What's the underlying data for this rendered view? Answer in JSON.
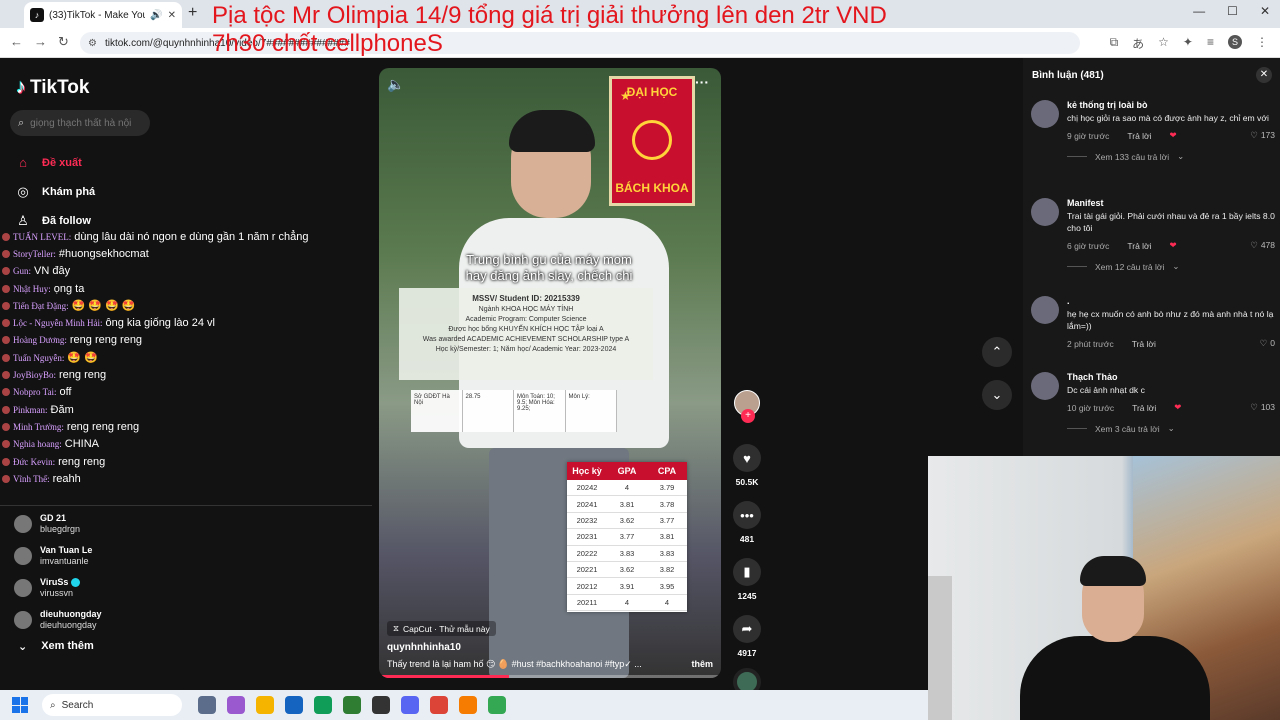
{
  "browser": {
    "tab_title": "(33)TikTok - Make Your Day",
    "tab_audio_icon": "🔊",
    "url": "tiktok.com/@quynhnhinha10/video/7###############",
    "new_tab": "+"
  },
  "headline": {
    "line1": "Pịa tộc Mr Olimpia  14/9 tổng giá trị giải thưởng lên den 2tr VND",
    "line2": "7h30 chốt cellphoneS"
  },
  "tiktok": {
    "logo": "TikTok",
    "search_placeholder": "giọng thạch thất hà nội",
    "nav": [
      {
        "label": "Đề xuất",
        "icon": "home-icon",
        "glyph": "⌂",
        "active": true
      },
      {
        "label": "Khám phá",
        "icon": "compass-icon",
        "glyph": "◎",
        "active": false
      },
      {
        "label": "Đã follow",
        "icon": "user-icon",
        "glyph": "♙",
        "active": false
      }
    ],
    "following": [
      {
        "name": "GD 21",
        "handle": "bluegdrgn",
        "verified": false
      },
      {
        "name": "Van Tuan Le",
        "handle": "imvantuanle",
        "verified": false
      },
      {
        "name": "ViruSs",
        "handle": "virussvn",
        "verified": true
      },
      {
        "name": "dieuhuongday",
        "handle": "dieuhuongday",
        "verified": false
      }
    ],
    "see_more": "Xem thêm"
  },
  "chat": [
    {
      "user": "TUẤN LEVEL:",
      "msg": "dùng lâu dài nó ngon e dùng gần 1 năm r chẳng"
    },
    {
      "user": "StoryTeller:",
      "msg": "#huongsekhocmat"
    },
    {
      "user": "Gun:",
      "msg": "VN đây"
    },
    {
      "user": "Nhật Huy:",
      "msg": "ọng ta"
    },
    {
      "user": "Tiến Đạt Đặng:",
      "msg": "🤩 🤩 🤩 🤩"
    },
    {
      "user": "Lộc - Nguyễn Minh Hải:",
      "msg": "ông kia giống lào 24 vl"
    },
    {
      "user": "Hoàng Dương:",
      "msg": "reng reng reng"
    },
    {
      "user": "Tuấn Nguyễn:",
      "msg": "🤩 🤩"
    },
    {
      "user": "JoyBioyBo:",
      "msg": "reng reng"
    },
    {
      "user": "Nobpro Tai:",
      "msg": "off"
    },
    {
      "user": "Pinkman:",
      "msg": "Đăm"
    },
    {
      "user": "Minh Trường:",
      "msg": "reng reng reng"
    },
    {
      "user": "Nghia hoang:",
      "msg": "CHINA"
    },
    {
      "user": "Đức Kevin:",
      "msg": "reng reng"
    },
    {
      "user": "Vĩnh Thế:",
      "msg": "reahh"
    }
  ],
  "video": {
    "caption_line1": "Trung bình gu của máy mom",
    "caption_line2": "hay đăng ảnh slay, chếch chi",
    "banner_top": "ĐẠI HỌC",
    "banner_bottom": "BÁCH KHOA",
    "cert_student_id": "MSSV/ Student ID: 20215339",
    "cert_major": "Ngành KHOA HỌC MÁY TÍNH",
    "cert_major_en": "Academic Program: Computer Science",
    "cert_award": "Được học bổng KHUYẾN KHÍCH HỌC TẬP loại A",
    "cert_award_en": "Was awarded ACADEMIC ACHIEVEMENT SCHOLARSHIP type A",
    "cert_semester": "Học kỳ/Semester:  1;        Năm học/ Academic Year: 2023-2024",
    "cert_row": [
      "Sở GDĐT Hà Nội",
      "28.75",
      "Môn Toán: 10; 9.5; Môn Hóa: 9.25;",
      "Môn Lý:"
    ],
    "gpa_headers": [
      "Học kỳ",
      "GPA",
      "CPA"
    ],
    "gpa_rows": [
      [
        "20242",
        "4",
        "3.79"
      ],
      [
        "20241",
        "3.81",
        "3.78"
      ],
      [
        "20232",
        "3.62",
        "3.77"
      ],
      [
        "20231",
        "3.77",
        "3.81"
      ],
      [
        "20222",
        "3.83",
        "3.83"
      ],
      [
        "20221",
        "3.62",
        "3.82"
      ],
      [
        "20212",
        "3.91",
        "3.95"
      ],
      [
        "20211",
        "4",
        "4"
      ]
    ],
    "capcut": "CapCut · Thử mẫu này",
    "author": "quynhnhinha10",
    "description": "Thấy trend là lại ham hố 😏 🥚 #hust  #bachkhoahanoi  #ftyp✓ ...",
    "description_more": "thêm",
    "progress": 0.38
  },
  "actions": {
    "likes": "50.5K",
    "comments": "481",
    "saves": "1245",
    "shares": "4917"
  },
  "comments_panel": {
    "title": "Bình luận (481)",
    "items": [
      {
        "name": "kẻ thống trị loài bò",
        "text": "chị học giỏi ra sao mà có được ảnh hay z, chỉ em với",
        "time": "9 giờ trước",
        "reply": "Trả lời",
        "likes": "173",
        "more": "Xem 133 câu trả lời"
      },
      {
        "name": "Manifest",
        "text": "Trai tài gái giỏi. Phải cưới nhau và đẻ ra 1 bầy ielts 8.0 cho tôi",
        "time": "6 giờ trước",
        "reply": "Trả lời",
        "likes": "478",
        "more": "Xem 12 câu trả lời"
      },
      {
        "name": ".",
        "text": "hẹ hẹ cx muốn có anh bò như z đó mà anh nhà t nó lạ lắm=))",
        "time": "2 phút trước",
        "reply": "Trả lời",
        "likes": "0",
        "more": ""
      },
      {
        "name": "Thạch Thảo",
        "text": "Dc cái ảnh nhạt dk c",
        "time": "10 giờ trước",
        "reply": "Trả lời",
        "likes": "103",
        "more": "Xem 3 câu trả lời"
      }
    ]
  },
  "taskbar": {
    "search_placeholder": "Search"
  },
  "colors": {
    "tiktok_red": "#fe2c55",
    "headline_red": "#e4161d",
    "bach_khoa_red": "#c8102e"
  }
}
